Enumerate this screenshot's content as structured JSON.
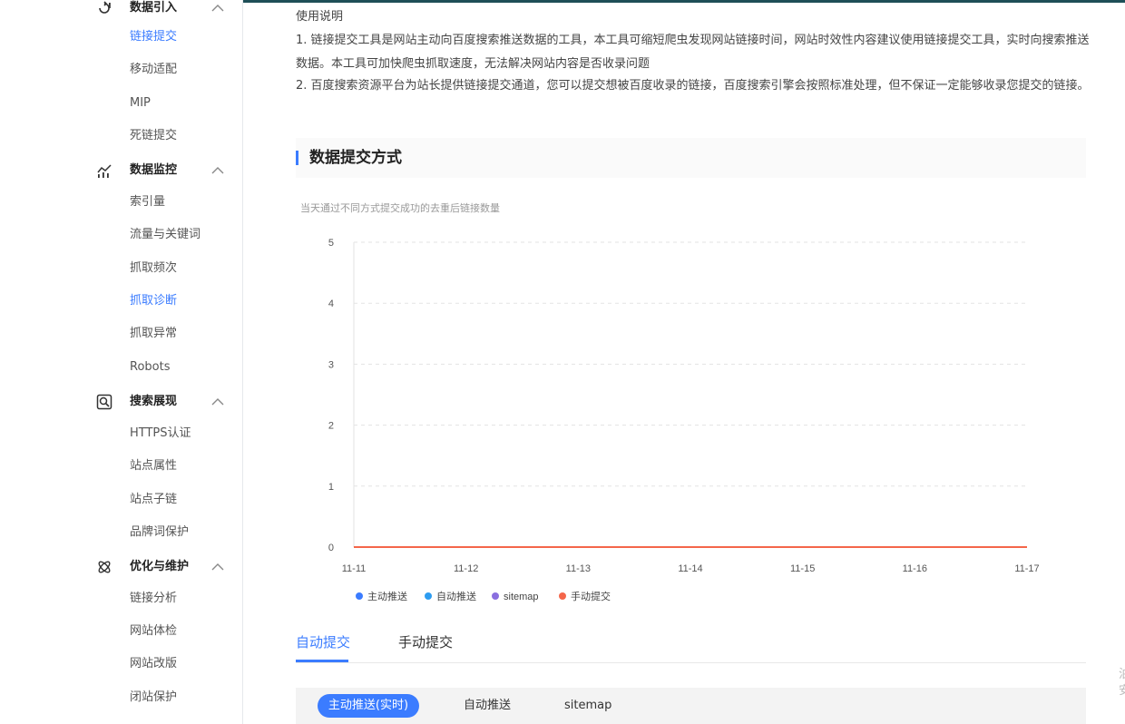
{
  "sidebar": {
    "groups": [
      {
        "label": "数据引入",
        "icon": "data-import-icon",
        "items": [
          {
            "label": "链接提交",
            "active": true
          },
          {
            "label": "移动适配",
            "active": false
          },
          {
            "label": "MIP",
            "active": false
          },
          {
            "label": "死链提交",
            "active": false
          }
        ]
      },
      {
        "label": "数据监控",
        "icon": "data-monitor-icon",
        "items": [
          {
            "label": "索引量",
            "active": false
          },
          {
            "label": "流量与关键词",
            "active": false
          },
          {
            "label": "抓取频次",
            "active": false
          },
          {
            "label": "抓取诊断",
            "active": true
          },
          {
            "label": "抓取异常",
            "active": false
          },
          {
            "label": "Robots",
            "active": false
          }
        ]
      },
      {
        "label": "搜索展现",
        "icon": "search-display-icon",
        "items": [
          {
            "label": "HTTPS认证",
            "active": false
          },
          {
            "label": "站点属性",
            "active": false
          },
          {
            "label": "站点子链",
            "active": false
          },
          {
            "label": "品牌词保护",
            "active": false
          }
        ]
      },
      {
        "label": "优化与维护",
        "icon": "optimize-icon",
        "items": [
          {
            "label": "链接分析",
            "active": false
          },
          {
            "label": "网站体检",
            "active": false
          },
          {
            "label": "网站改版",
            "active": false
          },
          {
            "label": "闭站保护",
            "active": false
          }
        ]
      }
    ]
  },
  "usage": {
    "title": "使用说明",
    "line1": "1. 链接提交工具是网站主动向百度搜索推送数据的工具，本工具可缩短爬虫发现网站链接时间，网站时效性内容建议使用链接提交工具，实时向搜索推送数据。本工具可加快爬虫抓取速度，无法解决网站内容是否收录问题",
    "line2": "2. 百度搜索资源平台为站长提供链接提交通道，您可以提交想被百度收录的链接，百度搜索引擎会按照标准处理，但不保证一定能够收录您提交的链接。"
  },
  "section": {
    "title": "数据提交方式"
  },
  "chart_data": {
    "type": "line",
    "title": "当天通过不同方式提交成功的去重后链接数量",
    "categories": [
      "11-11",
      "11-12",
      "11-13",
      "11-14",
      "11-15",
      "11-16",
      "11-17"
    ],
    "yticks": [
      "0",
      "1",
      "2",
      "3",
      "4",
      "5"
    ],
    "ylim": [
      0,
      5
    ],
    "grid": true,
    "legend_position": "bottom-left",
    "series": [
      {
        "name": "主动推送",
        "color": "#3b7cff",
        "values": [
          0,
          0,
          0,
          0,
          0,
          0,
          0
        ]
      },
      {
        "name": "自动推送",
        "color": "#2d9cf0",
        "values": [
          0,
          0,
          0,
          0,
          0,
          0,
          0
        ]
      },
      {
        "name": "sitemap",
        "color": "#8a6fdf",
        "values": [
          0,
          0,
          0,
          0,
          0,
          0,
          0
        ]
      },
      {
        "name": "手动提交",
        "color": "#f4664a",
        "values": [
          0,
          0,
          0,
          0,
          0,
          0,
          0
        ]
      }
    ]
  },
  "tabs": [
    {
      "label": "自动提交",
      "active": true
    },
    {
      "label": "手动提交",
      "active": false
    }
  ],
  "subtabs": [
    {
      "label": "主动推送(实时)",
      "active": true
    },
    {
      "label": "自动推送",
      "active": false
    },
    {
      "label": "sitemap",
      "active": false
    }
  ],
  "edge_glyph": "泊\n安",
  "colors": {
    "accent": "#3b7cff",
    "topbar": "#1e4f57"
  }
}
